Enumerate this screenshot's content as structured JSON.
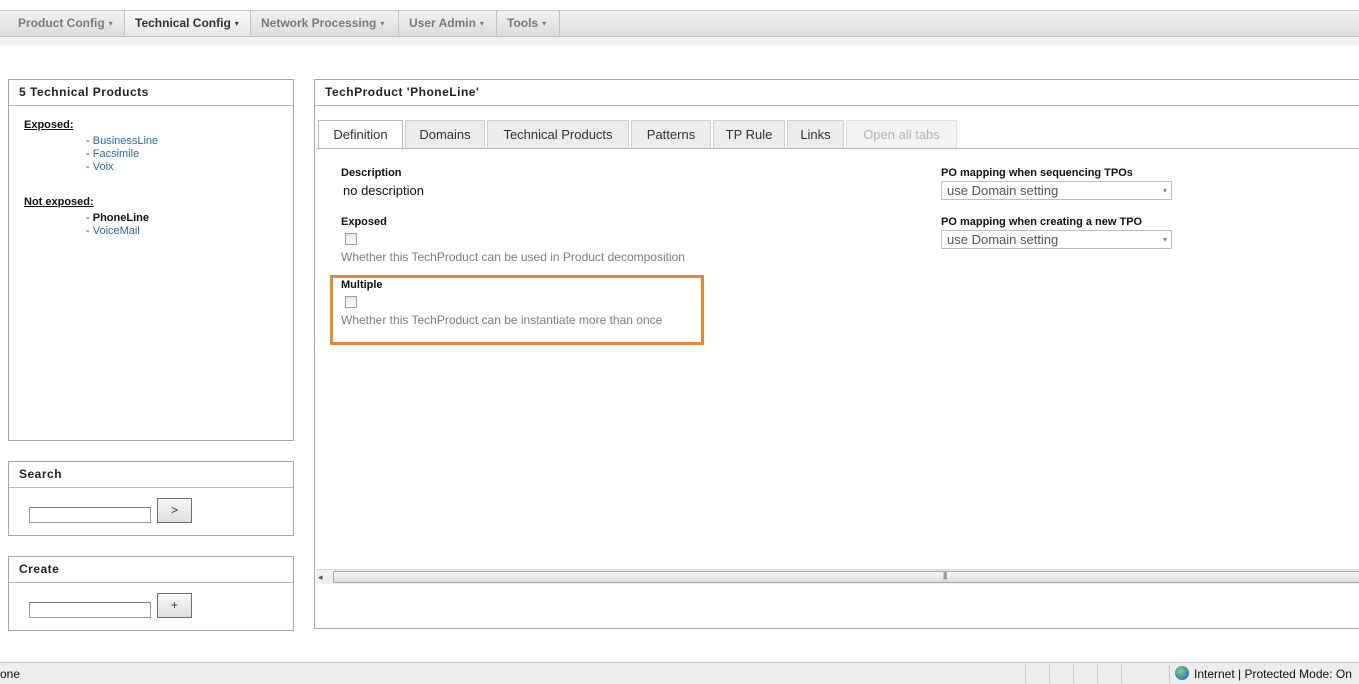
{
  "menu": {
    "items": [
      {
        "label": "Product Config",
        "active": false
      },
      {
        "label": "Technical Config",
        "active": true
      },
      {
        "label": "Network Processing",
        "active": false
      },
      {
        "label": "User Admin",
        "active": false
      },
      {
        "label": "Tools",
        "active": false
      }
    ],
    "caret_icon": "▾"
  },
  "products_panel": {
    "title": "5 Technical Products",
    "exposed_label": "Exposed:",
    "exposed": [
      "BusinessLine",
      "Facsimile",
      "Voix"
    ],
    "not_exposed_label": "Not exposed:",
    "not_exposed": [
      {
        "name": "PhoneLine",
        "current": true
      },
      {
        "name": "VoiceMail",
        "current": false
      }
    ],
    "bullet": "- "
  },
  "search_panel": {
    "title": "Search",
    "input_value": "",
    "button_label": ">"
  },
  "create_panel": {
    "title": "Create",
    "input_value": "",
    "button_label": "+"
  },
  "detail": {
    "title": "TechProduct 'PhoneLine'",
    "tabs": [
      {
        "label": "Definition",
        "state": "active"
      },
      {
        "label": "Domains",
        "state": "normal"
      },
      {
        "label": "Technical Products",
        "state": "normal"
      },
      {
        "label": "Patterns",
        "state": "normal"
      },
      {
        "label": "TP Rule",
        "state": "normal"
      },
      {
        "label": "Links",
        "state": "normal"
      },
      {
        "label": "Open all tabs",
        "state": "disabled"
      }
    ],
    "description_label": "Description",
    "description_value": "no description",
    "exposed_label": "Exposed",
    "exposed_checked": false,
    "exposed_help": "Whether this TechProduct can be used in Product decomposition",
    "multiple_label": "Multiple",
    "multiple_checked": false,
    "multiple_help": "Whether this TechProduct can be instantiate more than once",
    "po_seq_label": "PO mapping when sequencing TPOs",
    "po_seq_value": "use Domain setting",
    "po_new_label": "PO mapping when creating a new TPO",
    "po_new_value": "use Domain setting",
    "highlight_color": "#f0842b"
  },
  "statusbar": {
    "left_text": "one",
    "zone_text": "Internet | Protected Mode: On"
  }
}
